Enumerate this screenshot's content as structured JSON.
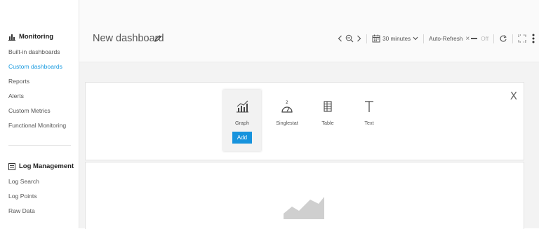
{
  "sidebar": {
    "monitoring": {
      "title": "Monitoring",
      "icon": "bar-chart-icon",
      "items": [
        {
          "label": "Built-in dashboards"
        },
        {
          "label": "Custom dashboards",
          "active": true
        },
        {
          "label": "Reports"
        },
        {
          "label": "Alerts"
        },
        {
          "label": "Custom Metrics"
        },
        {
          "label": "Functional Monitoring"
        }
      ]
    },
    "log_management": {
      "title": "Log Management",
      "icon": "log-icon",
      "items": [
        {
          "label": "Log Search"
        },
        {
          "label": "Log Points"
        },
        {
          "label": "Raw Data"
        }
      ]
    }
  },
  "header": {
    "title": "New dashboard",
    "time_range": "30 minutes",
    "auto_refresh_label": "Auto-Refresh",
    "auto_refresh_state": "Off"
  },
  "panel_picker": {
    "close": "X",
    "types": [
      {
        "label": "Graph",
        "icon": "graph-icon",
        "selected": true
      },
      {
        "label": "Singlestat",
        "icon": "gauge-icon"
      },
      {
        "label": "Table",
        "icon": "table-icon"
      },
      {
        "label": "Text",
        "icon": "text-icon"
      }
    ],
    "add_label": "Add"
  },
  "colors": {
    "accent": "#1793dd",
    "active_link": "#1a9be0",
    "content_bg": "#f3f3f3"
  }
}
